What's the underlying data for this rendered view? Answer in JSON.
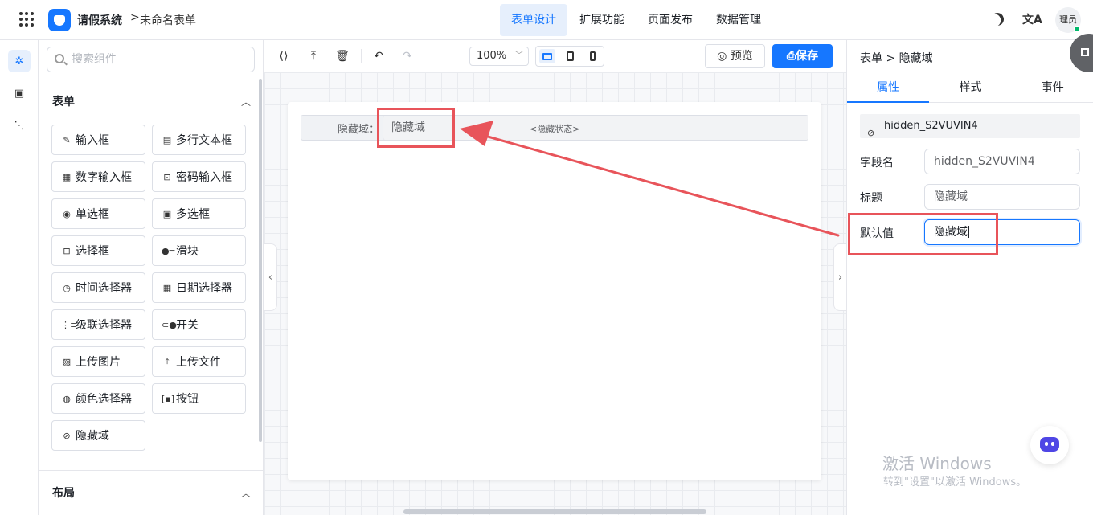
{
  "header": {
    "app_name": "请假系统",
    "crumb_sep": ">",
    "form_name": "未命名表单",
    "tabs": [
      {
        "label": "表单设计",
        "active": true
      },
      {
        "label": "扩展功能"
      },
      {
        "label": "页面发布"
      },
      {
        "label": "数据管理"
      }
    ],
    "translate_glyph": "文A",
    "avatar_text": "理员",
    "accent_color": "#1677ff"
  },
  "rail": {
    "items": [
      {
        "icon": "puzzle-icon",
        "glyph": "✲",
        "active": true
      },
      {
        "icon": "form-icon",
        "glyph": "▣"
      },
      {
        "icon": "tree-icon",
        "glyph": "⋱"
      }
    ]
  },
  "components": {
    "search_placeholder": "搜索组件",
    "form_section_title": "表单",
    "layout_section_title": "布局",
    "items": [
      {
        "label": "输入框",
        "icon": "pencil-icon",
        "glyph": "✎"
      },
      {
        "label": "多行文本框",
        "icon": "textarea-icon",
        "glyph": "▤"
      },
      {
        "label": "数字输入框",
        "icon": "number-icon",
        "glyph": "▦"
      },
      {
        "label": "密码输入框",
        "icon": "lock-icon",
        "glyph": "⊡"
      },
      {
        "label": "单选框",
        "icon": "radio-icon",
        "glyph": "◉"
      },
      {
        "label": "多选框",
        "icon": "checkbox-icon",
        "glyph": "▣"
      },
      {
        "label": "选择框",
        "icon": "select-icon",
        "glyph": "⊟"
      },
      {
        "label": "滑块",
        "icon": "slider-icon",
        "glyph": "●━"
      },
      {
        "label": "时间选择器",
        "icon": "clock-icon",
        "glyph": "◷"
      },
      {
        "label": "日期选择器",
        "icon": "calendar-icon",
        "glyph": "▦"
      },
      {
        "label": "级联选择器",
        "icon": "cascader-icon",
        "glyph": "⋮≡"
      },
      {
        "label": "开关",
        "icon": "switch-icon",
        "glyph": "⊂●"
      },
      {
        "label": "上传图片",
        "icon": "image-icon",
        "glyph": "▨"
      },
      {
        "label": "上传文件",
        "icon": "upload-icon",
        "glyph": "⤒"
      },
      {
        "label": "颜色选择器",
        "icon": "palette-icon",
        "glyph": "◍"
      },
      {
        "label": "按钮",
        "icon": "button-icon",
        "glyph": "[▪]"
      },
      {
        "label": "隐藏域",
        "icon": "eye-off-icon",
        "glyph": "⊘"
      }
    ]
  },
  "toolbar": {
    "zoom": "100%",
    "preview_label": "预览",
    "save_label": "保存",
    "device": "desktop"
  },
  "canvas": {
    "field_label": "隐藏域",
    "field_label_colon": "：",
    "field_value": "隐藏域",
    "field_state": "<隐藏状态>"
  },
  "properties": {
    "crumb_root": "表单",
    "crumb_sep": ">",
    "crumb_current": "隐藏域",
    "tabs": [
      {
        "label": "属性",
        "active": true
      },
      {
        "label": "样式"
      },
      {
        "label": "事件"
      }
    ],
    "field_id": "hidden_S2VUVIN4",
    "rows": [
      {
        "label": "字段名",
        "value": "hidden_S2VUVIN4"
      },
      {
        "label": "标题",
        "value": "隐藏域"
      },
      {
        "label": "默认值",
        "value": "隐藏域",
        "focused": true
      }
    ]
  },
  "watermark": {
    "title": "激活 Windows",
    "subtitle": "转到\"设置\"以激活 Windows。"
  },
  "annotation_color": "#e8545a"
}
